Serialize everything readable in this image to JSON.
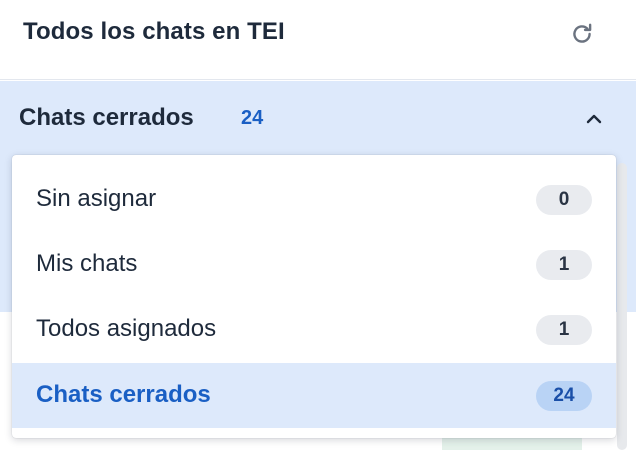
{
  "header": {
    "title": "Todos los chats en TEI",
    "refresh_icon": "refresh-icon"
  },
  "filter": {
    "label": "Chats cerrados",
    "count": "24",
    "chevron_icon": "chevron-up-icon"
  },
  "dropdown": {
    "items": [
      {
        "label": "Sin asignar",
        "count": "0",
        "selected": false
      },
      {
        "label": "Mis chats",
        "count": "1",
        "selected": false
      },
      {
        "label": "Todos asignados",
        "count": "1",
        "selected": false
      },
      {
        "label": "Chats cerrados",
        "count": "24",
        "selected": true
      }
    ]
  },
  "colors": {
    "accent": "#1a5fc4",
    "selected_bg": "#dde9fb",
    "text": "#1e2a3b",
    "badge_bg": "#e9ebef",
    "badge_selected_bg": "#b9d3f5"
  }
}
